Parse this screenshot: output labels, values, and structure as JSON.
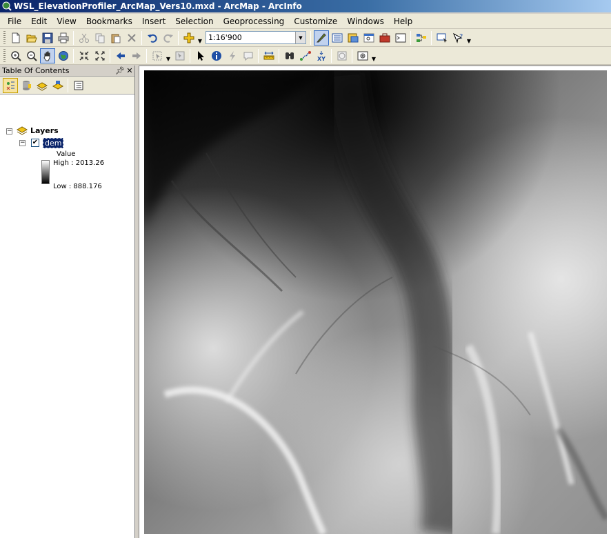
{
  "window": {
    "title": "WSL_ElevationProfiler_ArcMap_Vers10.mxd - ArcMap - ArcInfo"
  },
  "menubar": {
    "items": [
      "File",
      "Edit",
      "View",
      "Bookmarks",
      "Insert",
      "Selection",
      "Geoprocessing",
      "Customize",
      "Windows",
      "Help"
    ]
  },
  "standard_toolbar": {
    "icons": [
      "new-document-icon",
      "open-icon",
      "save-icon",
      "print-icon",
      "cut-icon",
      "copy-icon",
      "paste-icon",
      "delete-icon",
      "undo-icon",
      "redo-icon",
      "add-data-icon",
      "editor-toolbar-icon",
      "table-of-contents-icon",
      "catalog-icon",
      "search-icon",
      "arctoolbox-icon",
      "python-icon",
      "model-builder-icon",
      "whats-this-icon",
      "help-icon"
    ],
    "scale": "1:16'900"
  },
  "tools_toolbar": {
    "icons": [
      "zoom-in-icon",
      "zoom-out-icon",
      "pan-icon",
      "full-extent-icon",
      "fixed-zoom-in-icon",
      "fixed-zoom-out-icon",
      "back-icon",
      "forward-icon",
      "select-features-icon",
      "clear-selection-icon",
      "select-elements-icon",
      "identify-icon",
      "hyperlink-icon",
      "html-popup-icon",
      "measure-icon",
      "find-icon",
      "find-route-icon",
      "go-to-xy-icon",
      "time-slider-icon",
      "create-viewer-icon"
    ]
  },
  "toc": {
    "title": "Table Of Contents",
    "root_label": "Layers",
    "layer": {
      "name": "dem",
      "checked": true,
      "legend_field": "Value",
      "high_label": "High : 2013.26",
      "low_label": "Low : 888.176"
    }
  },
  "colors": {
    "title_bar": "#0a246a",
    "selection": "#0a246a",
    "chrome": "#ece9d8"
  }
}
